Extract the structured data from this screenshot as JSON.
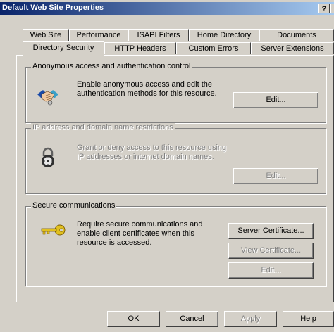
{
  "window": {
    "title": "Default Web Site Properties",
    "help_button": "?",
    "close_button": "×"
  },
  "tabs": {
    "row1": [
      "Web Site",
      "Performance",
      "ISAPI Filters",
      "Home Directory",
      "Documents"
    ],
    "row2": [
      "Directory Security",
      "HTTP Headers",
      "Custom Errors",
      "Server Extensions"
    ],
    "active": "Directory Security"
  },
  "anonymous": {
    "title": "Anonymous access and authentication control",
    "description": "Enable anonymous access and edit the authentication methods for this resource.",
    "line1": "Enable anonymous access and edit the",
    "line2": "authentication methods for this resource.",
    "edit_label": "Edit...",
    "icon": "handshake-icon"
  },
  "ip": {
    "title": "IP address and domain name restrictions",
    "line1": "Grant or deny access to this resource using",
    "line2": "IP addresses or internet domain names.",
    "edit_label": "Edit...",
    "icon": "padlock-icon"
  },
  "secure": {
    "title": "Secure communications",
    "line1": "Require secure communications and",
    "line2": "enable client certificates when this",
    "line3": "resource is accessed.",
    "server_cert_label": "Server Certificate...",
    "view_cert_label": "View Certificate...",
    "edit_label": "Edit...",
    "icon": "key-icon"
  },
  "footer": {
    "ok_label": "OK",
    "cancel_label": "Cancel",
    "apply_label": "Apply",
    "help_label": "Help"
  }
}
